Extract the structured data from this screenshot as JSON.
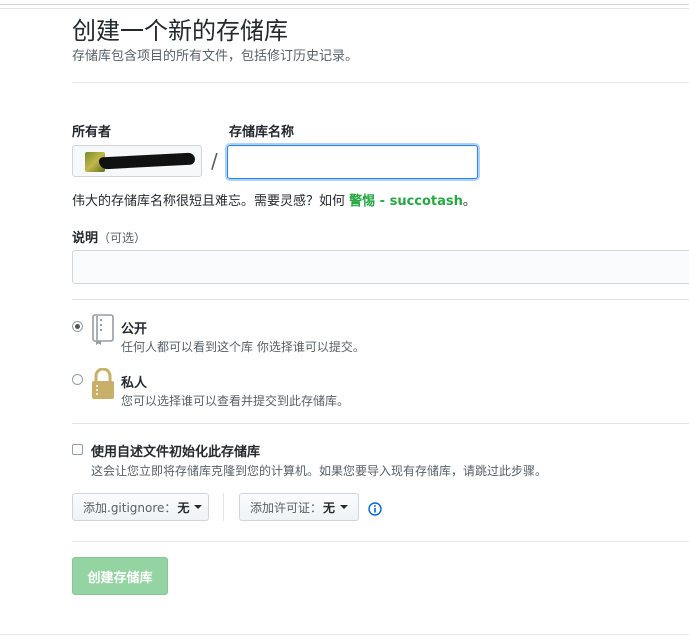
{
  "header": {
    "title": "创建一个新的存储库",
    "subtitle": "存储库包含项目的所有文件，包括修订历史记录。"
  },
  "owner": {
    "label": "所有者"
  },
  "repo_name": {
    "label": "存储库名称",
    "value": "",
    "separator": "/"
  },
  "hint": {
    "prefix": "伟大的存储库名称很短且难忘。需要灵感？如何 ",
    "suggestion": "警惕 - succotash",
    "suffix": "。"
  },
  "description": {
    "label": "说明",
    "optional": "（可选）",
    "value": ""
  },
  "visibility": {
    "public": {
      "title": "公开",
      "desc": "任何人都可以看到这个库 你选择谁可以提交。",
      "checked": true
    },
    "private": {
      "title": "私人",
      "desc": "您可以选择谁可以查看并提交到此存储库。",
      "checked": false
    }
  },
  "init": {
    "title": "使用自述文件初始化此存储库",
    "desc": "这会让您立即将存储库克隆到您的计算机。如果您要导入现有存储库，请跳过此步骤。",
    "checked": false
  },
  "gitignore": {
    "label": "添加.gitignore：",
    "value": "无"
  },
  "license": {
    "label": "添加许可证：",
    "value": "无"
  },
  "create_button": {
    "label": "创建存储库"
  },
  "colors": {
    "suggestion_green": "#28a745",
    "create_button_bg": "#94d3a2",
    "focus_blue": "#2188ff",
    "info_blue": "#0366d6"
  }
}
